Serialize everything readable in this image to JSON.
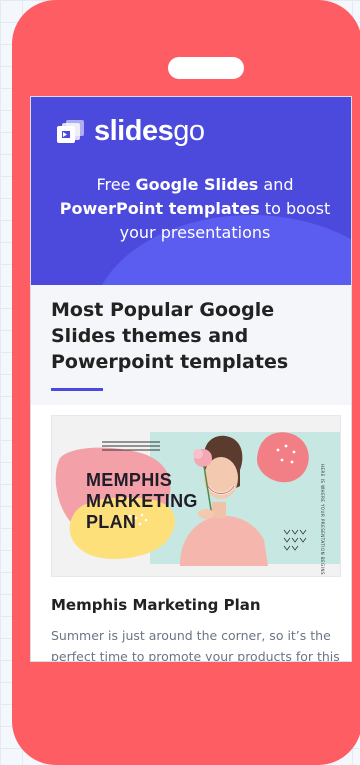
{
  "brand": {
    "name_bold": "slides",
    "name_light": "go"
  },
  "hero": {
    "tagline_1": "Free ",
    "tagline_bold_1": "Google Slides",
    "tagline_2": " and ",
    "tagline_bold_2": "PowerPoint templates",
    "tagline_3": " to boost your presentations"
  },
  "section": {
    "title": "Most Popular Google Slides themes and Powerpoint templates"
  },
  "featured": {
    "thumbnail_title": "MEMPHIS MARKETING PLAN",
    "thumbnail_side_text": "HERE IS WHERE YOUR PRESENTATION BEGINS",
    "title": "Memphis Marketing Plan",
    "description": "Summer is just around the corner, so it’s the perfect time to promote your products for this"
  },
  "colors": {
    "phone": "#fd5d63",
    "hero": "#4c4adc",
    "hero_blob": "#5b5cf0",
    "accent": "#4c4adc",
    "pink_blob": "#f4a0a8",
    "yellow_blob": "#fde07a",
    "mint_bg": "#c7e7e3"
  },
  "icons": {
    "logo": "slidesgo-logo-icon"
  }
}
